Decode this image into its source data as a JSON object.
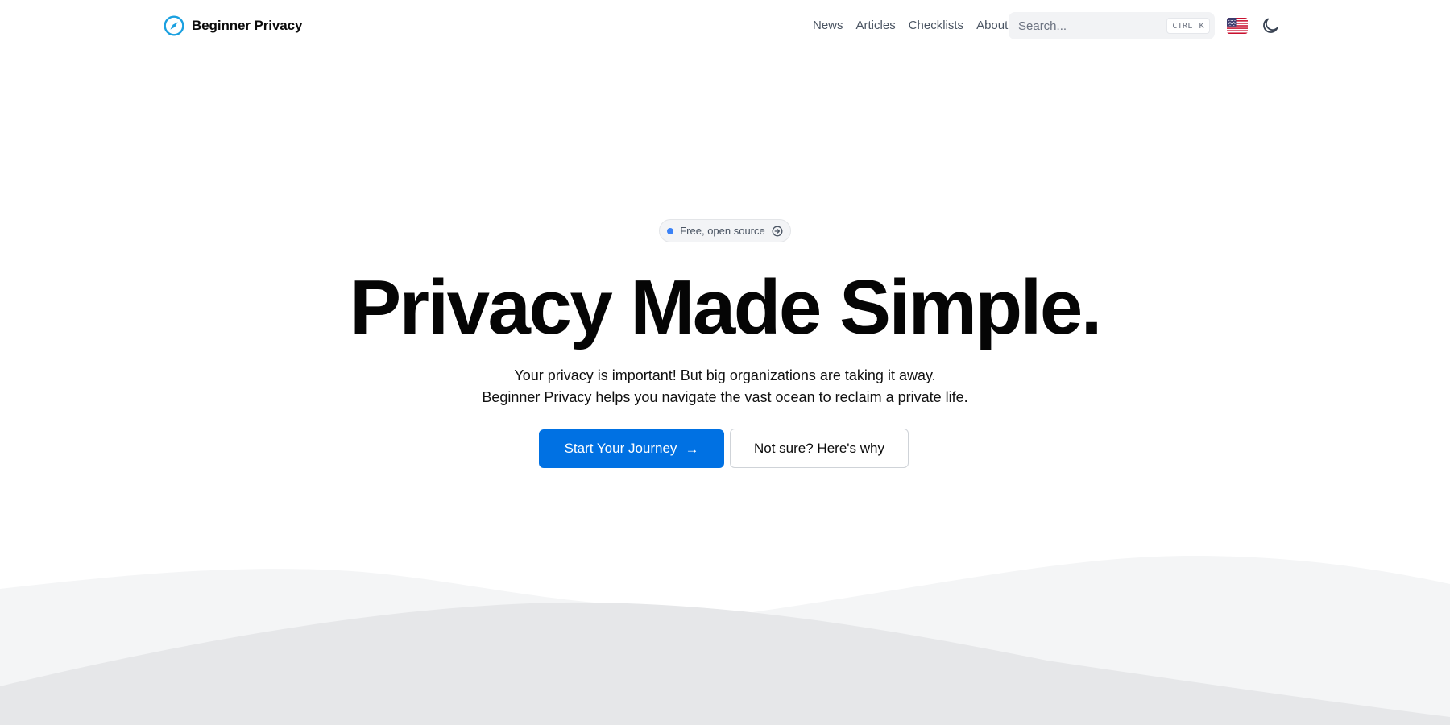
{
  "brand": {
    "name": "Beginner Privacy",
    "icon": "compass-icon"
  },
  "nav": {
    "items": [
      {
        "label": "News"
      },
      {
        "label": "Articles"
      },
      {
        "label": "Checklists"
      },
      {
        "label": "About"
      }
    ]
  },
  "search": {
    "placeholder": "Search...",
    "shortcut_modifier": "CTRL",
    "shortcut_key": "K"
  },
  "language": {
    "icon": "us-flag-icon"
  },
  "theme_toggle": {
    "icon": "moon-icon"
  },
  "hero": {
    "badge_label": "Free, open source",
    "title": "Privacy Made Simple.",
    "subtitle_line1": "Your privacy is important! But big organizations are taking it away.",
    "subtitle_line2": "Beginner Privacy helps you navigate the vast ocean to reclaim a private life.",
    "primary_cta": "Start Your Journey",
    "primary_cta_arrow": "→",
    "secondary_cta": "Not sure? Here's why"
  },
  "colors": {
    "accent": "#0071e3",
    "brand_icon": "#1aa0e0",
    "badge_dot": "#3b82f6",
    "wave_light": "#f4f5f6",
    "wave_dark": "#e6e7e9"
  }
}
